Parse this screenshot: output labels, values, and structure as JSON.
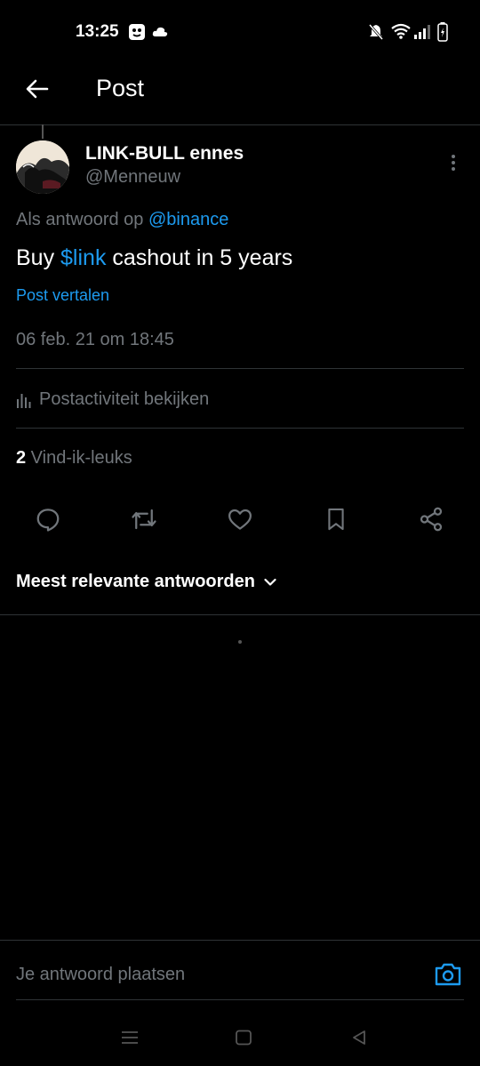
{
  "status_bar": {
    "time": "13:25"
  },
  "header": {
    "title": "Post"
  },
  "post": {
    "display_name": "LINK-BULL ennes",
    "handle": "@Menneuw",
    "reply_prefix": "Als antwoord op ",
    "reply_mention": "@binance",
    "text_before": "Buy ",
    "cashtag": "$link",
    "text_after": " cashout in 5 years",
    "translate_label": "Post vertalen",
    "timestamp": "06 feb. 21 om 18:45",
    "activity_label": "Postactiviteit bekijken",
    "likes_count": "2",
    "likes_label": " Vind-ik-leuks"
  },
  "replies": {
    "sort_label": "Meest relevante antwoorden"
  },
  "composer": {
    "placeholder": "Je antwoord plaatsen"
  },
  "colors": {
    "accent": "#1d9bf0",
    "muted": "#71767b",
    "divider": "#2f3336"
  }
}
